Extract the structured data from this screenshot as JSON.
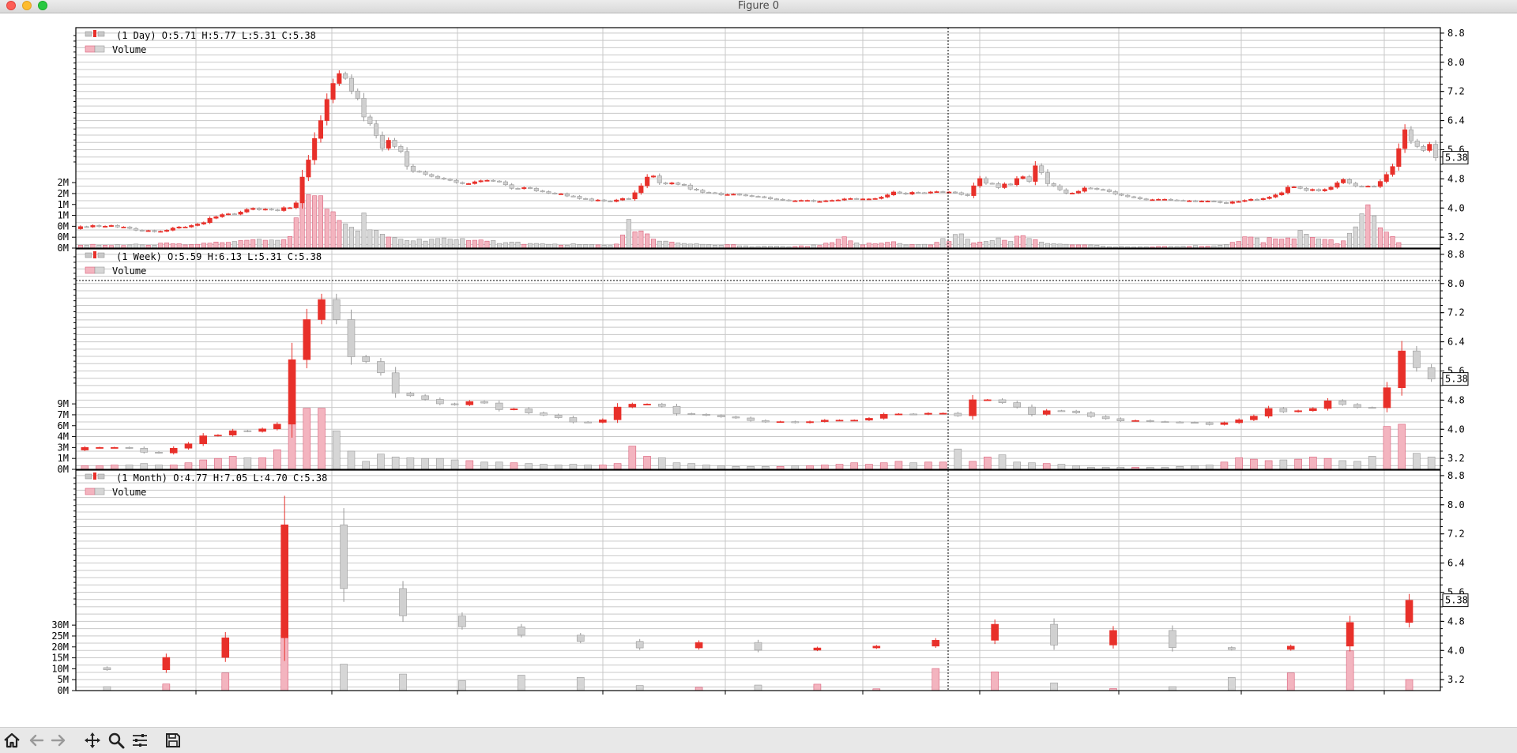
{
  "window": {
    "title": "Figure 0",
    "controls": [
      "close",
      "minimize",
      "maximize"
    ]
  },
  "toolbar": {
    "buttons": [
      {
        "name": "home-icon",
        "action": "Reset original view"
      },
      {
        "name": "back-icon",
        "action": "Back to previous view"
      },
      {
        "name": "forward-icon",
        "action": "Forward to next view"
      },
      {
        "name": "pan-icon",
        "action": "Pan axes"
      },
      {
        "name": "zoom-icon",
        "action": "Zoom to rectangle"
      },
      {
        "name": "configure-subplots-icon",
        "action": "Configure subplots"
      },
      {
        "name": "save-icon",
        "action": "Save the figure"
      }
    ]
  },
  "colors": {
    "up": "#e8302a",
    "down_edge": "#9a9a9a",
    "down_fill": "#d0d0d0",
    "volume_up_fill": "#f3b4bf",
    "volume_up_edge": "#d9607a",
    "volume_down_fill": "#d6d6d6",
    "grid": "#c8c8c8"
  },
  "chart_data": [
    {
      "type": "candlestick",
      "legend": [
        "(1 Day) O:5.71 H:5.77 L:5.31 C:5.38",
        "Volume"
      ],
      "last_price_label": "5.38",
      "price_axis": {
        "ticks": [
          "8.8",
          "8.0",
          "7.2",
          "6.4",
          "5.6",
          "4.8",
          "4.0",
          "3.2"
        ],
        "ylim": [
          2.9,
          8.95
        ]
      },
      "volume_axis": {
        "ticks": [
          "0M",
          "0M",
          "0M",
          "1M",
          "1M",
          "2M",
          "2M"
        ],
        "ylim": [
          0,
          2.5
        ]
      },
      "candles": {
        "open": [
          3.43,
          3.49,
          3.48,
          3.52,
          3.49,
          3.5,
          3.52,
          3.48,
          3.48,
          3.44,
          3.39,
          3.37,
          3.38,
          3.35,
          3.36,
          3.39,
          3.45,
          3.48,
          3.48,
          3.52,
          3.56,
          3.6,
          3.72,
          3.76,
          3.82,
          3.84,
          3.83,
          3.89,
          3.96,
          3.99,
          3.95,
          3.97,
          3.95,
          3.93,
          4.01,
          4.01,
          4.14,
          4.85,
          5.32,
          5.91,
          6.4,
          6.98,
          7.42,
          7.69,
          7.56,
          7.21,
          7.01,
          6.5,
          6.31,
          5.99,
          5.64,
          5.86,
          5.69,
          5.55,
          5.15,
          5.01,
          4.99,
          4.92,
          4.87,
          4.82,
          4.79,
          4.76,
          4.7,
          4.67,
          4.67,
          4.72,
          4.75,
          4.76,
          4.74,
          4.72,
          4.64,
          4.54,
          4.53,
          4.56,
          4.54,
          4.47,
          4.45,
          4.41,
          4.39,
          4.39,
          4.33,
          4.32,
          4.26,
          4.25,
          4.2,
          4.22,
          4.19,
          4.18,
          4.22,
          4.26,
          4.25,
          4.42,
          4.61,
          4.85,
          4.88,
          4.69,
          4.66,
          4.69,
          4.65,
          4.63,
          4.52,
          4.49,
          4.43,
          4.42,
          4.41,
          4.36,
          4.37,
          4.38,
          4.36,
          4.34,
          4.32,
          4.31,
          4.29,
          4.25,
          4.24,
          4.22,
          4.2,
          4.2,
          4.21,
          4.21,
          4.18,
          4.18,
          4.2,
          4.21,
          4.22,
          4.25,
          4.26,
          4.25,
          4.25,
          4.25,
          4.26,
          4.3,
          4.36,
          4.44,
          4.41,
          4.38,
          4.43,
          4.42,
          4.41,
          4.44,
          4.45,
          4.44,
          4.44,
          4.42,
          4.37,
          4.34,
          4.61,
          4.81,
          4.68,
          4.67,
          4.56,
          4.66,
          4.64,
          4.81,
          4.86,
          4.73,
          5.16,
          4.97,
          4.67,
          4.61,
          4.5,
          4.41,
          4.41,
          4.46,
          4.55,
          4.54,
          4.51,
          4.5,
          4.45,
          4.38,
          4.35,
          4.31,
          4.29,
          4.25,
          4.23,
          4.23,
          4.24,
          4.24,
          4.22,
          4.21,
          4.2,
          4.2,
          4.18,
          4.19,
          4.19,
          4.18,
          4.15,
          4.13,
          4.17,
          4.18,
          4.21,
          4.24,
          4.23,
          4.26,
          4.3,
          4.36,
          4.42,
          4.57,
          4.58,
          4.54,
          4.48,
          4.51,
          4.47,
          4.51,
          4.57,
          4.69,
          4.78,
          4.68,
          4.6,
          4.59,
          4.6,
          4.59,
          4.73,
          4.92,
          5.14,
          5.63,
          6.15,
          5.84,
          5.69,
          5.58,
          5.75
        ],
        "close": [
          3.49,
          3.48,
          3.52,
          3.49,
          3.5,
          3.52,
          3.48,
          3.48,
          3.44,
          3.39,
          3.37,
          3.38,
          3.35,
          3.36,
          3.39,
          3.45,
          3.48,
          3.48,
          3.52,
          3.56,
          3.6,
          3.72,
          3.76,
          3.82,
          3.84,
          3.83,
          3.89,
          3.96,
          3.99,
          3.95,
          3.97,
          3.95,
          3.93,
          4.01,
          4.01,
          4.14,
          4.85,
          5.32,
          5.91,
          6.4,
          6.98,
          7.42,
          7.69,
          7.56,
          7.21,
          7.01,
          6.5,
          6.31,
          5.99,
          5.64,
          5.86,
          5.69,
          5.55,
          5.15,
          5.01,
          4.99,
          4.92,
          4.87,
          4.82,
          4.79,
          4.76,
          4.7,
          4.67,
          4.67,
          4.72,
          4.75,
          4.76,
          4.74,
          4.72,
          4.64,
          4.54,
          4.53,
          4.56,
          4.54,
          4.47,
          4.45,
          4.41,
          4.39,
          4.39,
          4.33,
          4.32,
          4.26,
          4.25,
          4.2,
          4.22,
          4.19,
          4.18,
          4.22,
          4.26,
          4.25,
          4.42,
          4.61,
          4.85,
          4.88,
          4.69,
          4.66,
          4.69,
          4.65,
          4.63,
          4.52,
          4.49,
          4.43,
          4.42,
          4.41,
          4.36,
          4.37,
          4.38,
          4.36,
          4.34,
          4.32,
          4.31,
          4.29,
          4.25,
          4.24,
          4.22,
          4.2,
          4.2,
          4.21,
          4.21,
          4.18,
          4.18,
          4.2,
          4.21,
          4.22,
          4.25,
          4.26,
          4.25,
          4.25,
          4.25,
          4.26,
          4.3,
          4.36,
          4.44,
          4.41,
          4.38,
          4.43,
          4.42,
          4.41,
          4.44,
          4.45,
          4.44,
          4.44,
          4.42,
          4.37,
          4.34,
          4.61,
          4.81,
          4.68,
          4.67,
          4.56,
          4.66,
          4.64,
          4.81,
          4.86,
          4.73,
          5.16,
          4.97,
          4.67,
          4.61,
          4.5,
          4.41,
          4.41,
          4.46,
          4.55,
          4.54,
          4.51,
          4.5,
          4.45,
          4.38,
          4.35,
          4.31,
          4.29,
          4.25,
          4.23,
          4.23,
          4.24,
          4.24,
          4.22,
          4.21,
          4.2,
          4.2,
          4.18,
          4.19,
          4.19,
          4.18,
          4.15,
          4.13,
          4.17,
          4.18,
          4.21,
          4.24,
          4.23,
          4.26,
          4.3,
          4.36,
          4.42,
          4.57,
          4.58,
          4.54,
          4.48,
          4.51,
          4.47,
          4.51,
          4.57,
          4.69,
          4.78,
          4.68,
          4.6,
          4.59,
          4.6,
          4.59,
          4.73,
          4.92,
          5.14,
          5.63,
          6.15,
          5.84,
          5.69,
          5.58,
          5.75,
          5.38
        ],
        "volume": [
          0.1,
          0.1,
          0.13,
          0.1,
          0.1,
          0.09,
          0.12,
          0.09,
          0.11,
          0.14,
          0.11,
          0.1,
          0.1,
          0.17,
          0.18,
          0.15,
          0.15,
          0.11,
          0.12,
          0.13,
          0.17,
          0.17,
          0.21,
          0.19,
          0.2,
          0.23,
          0.26,
          0.27,
          0.29,
          0.31,
          0.27,
          0.28,
          0.27,
          0.29,
          0.4,
          1.04,
          1.85,
          1.84,
          1.8,
          1.8,
          1.34,
          1.25,
          0.95,
          0.83,
          0.72,
          0.59,
          1.21,
          0.63,
          0.61,
          0.48,
          0.38,
          0.36,
          0.31,
          0.26,
          0.25,
          0.32,
          0.24,
          0.31,
          0.33,
          0.35,
          0.31,
          0.29,
          0.33,
          0.26,
          0.27,
          0.28,
          0.24,
          0.26,
          0.16,
          0.19,
          0.21,
          0.21,
          0.13,
          0.16,
          0.16,
          0.15,
          0.13,
          0.14,
          0.1,
          0.1,
          0.15,
          0.12,
          0.12,
          0.12,
          0.11,
          0.1,
          0.09,
          0.14,
          0.45,
          0.99,
          0.56,
          0.59,
          0.49,
          0.31,
          0.24,
          0.24,
          0.21,
          0.18,
          0.16,
          0.14,
          0.15,
          0.13,
          0.12,
          0.1,
          0.1,
          0.12,
          0.12,
          0.08,
          0.08,
          0.05,
          0.06,
          0.07,
          0.07,
          0.07,
          0.06,
          0.05,
          0.06,
          0.08,
          0.06,
          0.11,
          0.09,
          0.17,
          0.19,
          0.31,
          0.39,
          0.25,
          0.18,
          0.11,
          0.17,
          0.15,
          0.17,
          0.2,
          0.22,
          0.16,
          0.11,
          0.12,
          0.12,
          0.13,
          0.11,
          0.2,
          0.33,
          0.23,
          0.47,
          0.49,
          0.31,
          0.18,
          0.21,
          0.23,
          0.26,
          0.35,
          0.27,
          0.23,
          0.41,
          0.43,
          0.33,
          0.29,
          0.21,
          0.16,
          0.15,
          0.14,
          0.13,
          0.11,
          0.11,
          0.11,
          0.11,
          0.1,
          0.07,
          0.05,
          0.04,
          0.06,
          0.05,
          0.04,
          0.05,
          0.05,
          0.04,
          0.06,
          0.06,
          0.06,
          0.06,
          0.07,
          0.06,
          0.09,
          0.06,
          0.07,
          0.08,
          0.1,
          0.12,
          0.2,
          0.23,
          0.39,
          0.38,
          0.35,
          0.19,
          0.36,
          0.32,
          0.31,
          0.35,
          0.32,
          0.61,
          0.48,
          0.37,
          0.32,
          0.3,
          0.29,
          0.15,
          0.25,
          0.51,
          0.73,
          1.18,
          1.49,
          1.11,
          0.7,
          0.55,
          0.4,
          0.19
        ]
      }
    },
    {
      "type": "candlestick",
      "legend": [
        "(1 Week) O:5.59 H:6.13 L:5.31 C:5.38",
        "Volume"
      ],
      "last_price_label": "5.38",
      "price_axis": {
        "ticks": [
          "8.8",
          "8.0",
          "7.2",
          "6.4",
          "5.6",
          "4.8",
          "4.0",
          "3.2"
        ],
        "ylim": [
          2.9,
          8.95
        ]
      },
      "volume_axis": {
        "ticks": [
          "0M",
          "1M",
          "3M",
          "4M",
          "6M",
          "7M",
          "9M"
        ],
        "ylim": [
          0,
          10
        ]
      },
      "candles": {
        "open": [
          3.43,
          3.5,
          3.5,
          3.5,
          3.48,
          3.37,
          3.35,
          3.48,
          3.6,
          3.82,
          3.84,
          3.96,
          3.94,
          4.01,
          4.14,
          5.91,
          7.01,
          7.56,
          7.01,
          5.99,
          5.86,
          5.55,
          4.99,
          4.92,
          4.82,
          4.7,
          4.67,
          4.76,
          4.72,
          4.54,
          4.56,
          4.45,
          4.39,
          4.32,
          4.2,
          4.19,
          4.26,
          4.61,
          4.69,
          4.69,
          4.63,
          4.43,
          4.41,
          4.38,
          4.34,
          4.31,
          4.24,
          4.2,
          4.21,
          4.18,
          4.21,
          4.25,
          4.25,
          4.25,
          4.3,
          4.41,
          4.42,
          4.41,
          4.44,
          4.44,
          4.37,
          4.81,
          4.81,
          4.73,
          4.61,
          4.41,
          4.51,
          4.5,
          4.45,
          4.35,
          4.29,
          4.23,
          4.24,
          4.21,
          4.2,
          4.19,
          4.18,
          4.13,
          4.18,
          4.26,
          4.36,
          4.57,
          4.48,
          4.51,
          4.57,
          4.78,
          4.68,
          4.6,
          4.59,
          5.14,
          6.15,
          5.69
        ],
        "close": [
          3.5,
          3.5,
          3.5,
          3.48,
          3.37,
          3.35,
          3.48,
          3.6,
          3.82,
          3.84,
          3.96,
          3.94,
          4.01,
          4.14,
          5.91,
          7.01,
          7.56,
          7.01,
          5.99,
          5.86,
          5.55,
          4.99,
          4.92,
          4.82,
          4.7,
          4.67,
          4.76,
          4.72,
          4.54,
          4.56,
          4.45,
          4.39,
          4.32,
          4.2,
          4.19,
          4.26,
          4.61,
          4.69,
          4.69,
          4.63,
          4.43,
          4.41,
          4.38,
          4.34,
          4.31,
          4.24,
          4.2,
          4.21,
          4.18,
          4.21,
          4.25,
          4.25,
          4.25,
          4.3,
          4.41,
          4.42,
          4.41,
          4.44,
          4.44,
          4.37,
          4.81,
          4.81,
          4.73,
          4.61,
          4.41,
          4.51,
          4.5,
          4.45,
          4.35,
          4.29,
          4.23,
          4.24,
          4.21,
          4.2,
          4.19,
          4.18,
          4.13,
          4.18,
          4.26,
          4.36,
          4.57,
          4.48,
          4.51,
          4.57,
          4.78,
          4.68,
          4.6,
          4.59,
          5.14,
          6.15,
          5.69,
          5.38
        ],
        "volume": [
          0.5,
          0.5,
          0.6,
          0.6,
          0.8,
          0.6,
          0.6,
          0.9,
          1.3,
          1.5,
          1.8,
          1.6,
          1.6,
          2.7,
          7.4,
          8.4,
          8.4,
          5.3,
          2.5,
          1.1,
          2.1,
          1.7,
          1.6,
          1.5,
          1.5,
          1.3,
          1.2,
          1.0,
          1.0,
          0.9,
          0.8,
          0.7,
          0.6,
          0.7,
          0.6,
          0.6,
          0.8,
          3.2,
          1.8,
          1.6,
          0.9,
          0.8,
          0.6,
          0.5,
          0.4,
          0.4,
          0.4,
          0.4,
          0.5,
          0.5,
          0.6,
          0.7,
          0.9,
          0.7,
          0.9,
          1.1,
          0.9,
          1.0,
          1.0,
          2.8,
          1.1,
          1.7,
          2.0,
          1.0,
          0.9,
          0.8,
          0.7,
          0.5,
          0.3,
          0.3,
          0.3,
          0.3,
          0.3,
          0.3,
          0.4,
          0.5,
          0.6,
          1.0,
          1.6,
          1.4,
          1.2,
          1.3,
          1.4,
          1.7,
          1.5,
          1.2,
          1.1,
          1.8,
          5.9,
          6.2,
          2.2,
          1.7
        ]
      }
    },
    {
      "type": "candlestick",
      "legend": [
        "(1 Month) O:4.77 H:7.05 L:4.70 C:5.38",
        "Volume"
      ],
      "last_price_label": "5.38",
      "price_axis": {
        "ticks": [
          "8.8",
          "8.0",
          "7.2",
          "6.4",
          "5.6",
          "4.8",
          "4.0",
          "3.2"
        ],
        "ylim": [
          2.9,
          8.95
        ]
      },
      "volume_axis": {
        "ticks": [
          "0M",
          "5M",
          "10M",
          "15M",
          "20M",
          "25M",
          "30M"
        ],
        "ylim": [
          0,
          33
        ]
      },
      "candles": {
        "open": [
          3.53,
          3.47,
          3.81,
          4.35,
          7.45,
          5.7,
          4.95,
          4.65,
          4.42,
          4.25,
          4.07,
          4.22,
          4.01,
          4.07,
          4.12,
          4.28,
          4.72,
          4.15,
          4.55,
          4.08,
          4.03,
          4.12,
          4.77
        ],
        "close": [
          3.47,
          3.81,
          4.35,
          7.45,
          5.7,
          4.95,
          4.65,
          4.42,
          4.25,
          4.07,
          4.22,
          4.01,
          4.07,
          4.12,
          4.28,
          4.72,
          4.15,
          4.55,
          4.08,
          4.03,
          4.12,
          4.77,
          5.38
        ],
        "volume": [
          1.8,
          3.0,
          8.0,
          28.0,
          12.0,
          7.5,
          4.5,
          7.0,
          6.0,
          2.3,
          1.5,
          2.5,
          2.9,
          0.8,
          10.0,
          8.5,
          3.5,
          0.9,
          1.8,
          6.0,
          8.0,
          18.0,
          5.0
        ]
      }
    }
  ]
}
